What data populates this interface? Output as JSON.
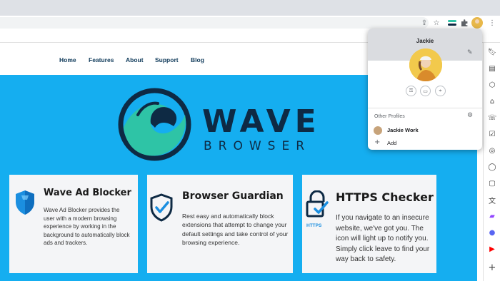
{
  "toolbar": {
    "icons": [
      "share-icon",
      "star-icon",
      "extension-toggle-icon",
      "puzzle-icon",
      "profile-avatar",
      "more-icon"
    ]
  },
  "site_nav": {
    "items": [
      {
        "label": "Home"
      },
      {
        "label": "Features"
      },
      {
        "label": "About"
      },
      {
        "label": "Support"
      },
      {
        "label": "Blog"
      }
    ]
  },
  "hero": {
    "logo_word": "WAVE",
    "logo_sub": "BROWSER"
  },
  "cards": [
    {
      "title": "Wave Ad Blocker",
      "body": "Wave Ad Blocker provides the user with a modern browsing experience by working in the background to automatically block ads and trackers.",
      "icon": "shield-icon"
    },
    {
      "title": "Browser Guardian",
      "body": "Rest easy and automatically block extensions that attempt to change your default settings and take control of your browsing experience.",
      "icon": "shield-check-icon"
    },
    {
      "title": "HTTPS Checker",
      "body": "If you navigate to an insecure website, we've got you. The icon will light up to notify you. Simply click leave to find your way back to safety.",
      "icon_label": "HTTPS",
      "icon": "padlock-check-icon"
    }
  ],
  "profile_popup": {
    "name": "Jackie",
    "buttons": [
      "key-icon",
      "card-icon",
      "location-icon"
    ],
    "other_profiles_label": "Other Profiles",
    "profiles": [
      {
        "name": "Jackie Work"
      }
    ],
    "add_label": "Add"
  },
  "colors": {
    "hero_bg": "#15aef0",
    "brand_dark": "#0e2a44",
    "brand_teal": "#2ec4a6"
  }
}
